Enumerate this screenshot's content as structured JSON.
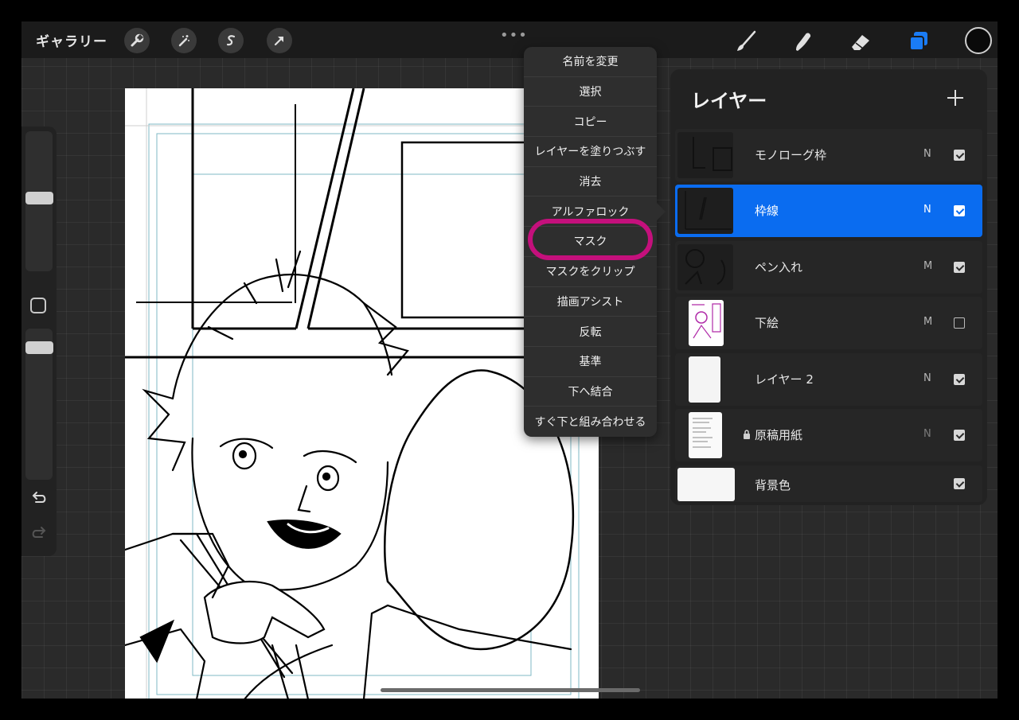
{
  "topbar": {
    "gallery_label": "ギャラリー",
    "tools_left": [
      "wrench-icon",
      "magic-wand-icon",
      "selection-s-icon",
      "transform-arrow-icon"
    ],
    "menu_dots": "•••",
    "tools_right": [
      "brush-icon",
      "smudge-icon",
      "eraser-icon",
      "layers-icon"
    ],
    "active_tool_color": "#1a7cf5",
    "current_color": "#0a0a0a"
  },
  "sidebar": {
    "brush_size_level": 0.35,
    "opacity_level": 0.2
  },
  "context_menu": {
    "items": [
      "名前を変更",
      "選択",
      "コピー",
      "レイヤーを塗りつぶす",
      "消去",
      "アルファロック",
      "マスク",
      "マスクをクリップ",
      "描画アシスト",
      "反転",
      "基準",
      "下へ結合",
      "すぐ下と組み合わせる"
    ],
    "highlighted_item": "マスク",
    "highlight_color": "#c4107c"
  },
  "layers_panel": {
    "title": "レイヤー",
    "add_icon": "plus-icon",
    "accent_color": "#0a6cf0",
    "layers": [
      {
        "name": "モノローグ枠",
        "mode": "N",
        "visible": true,
        "active": false,
        "locked": false
      },
      {
        "name": "枠線",
        "mode": "N",
        "visible": true,
        "active": true,
        "locked": false
      },
      {
        "name": "ペン入れ",
        "mode": "M",
        "visible": true,
        "active": false,
        "locked": false
      },
      {
        "name": "下絵",
        "mode": "M",
        "visible": false,
        "active": false,
        "locked": false
      },
      {
        "name": "レイヤー 2",
        "mode": "N",
        "visible": true,
        "active": false,
        "locked": false
      },
      {
        "name": "原稿用紙",
        "mode": "N",
        "visible": true,
        "active": false,
        "locked": true
      },
      {
        "name": "背景色",
        "mode": "",
        "visible": true,
        "active": false,
        "locked": false
      }
    ]
  }
}
